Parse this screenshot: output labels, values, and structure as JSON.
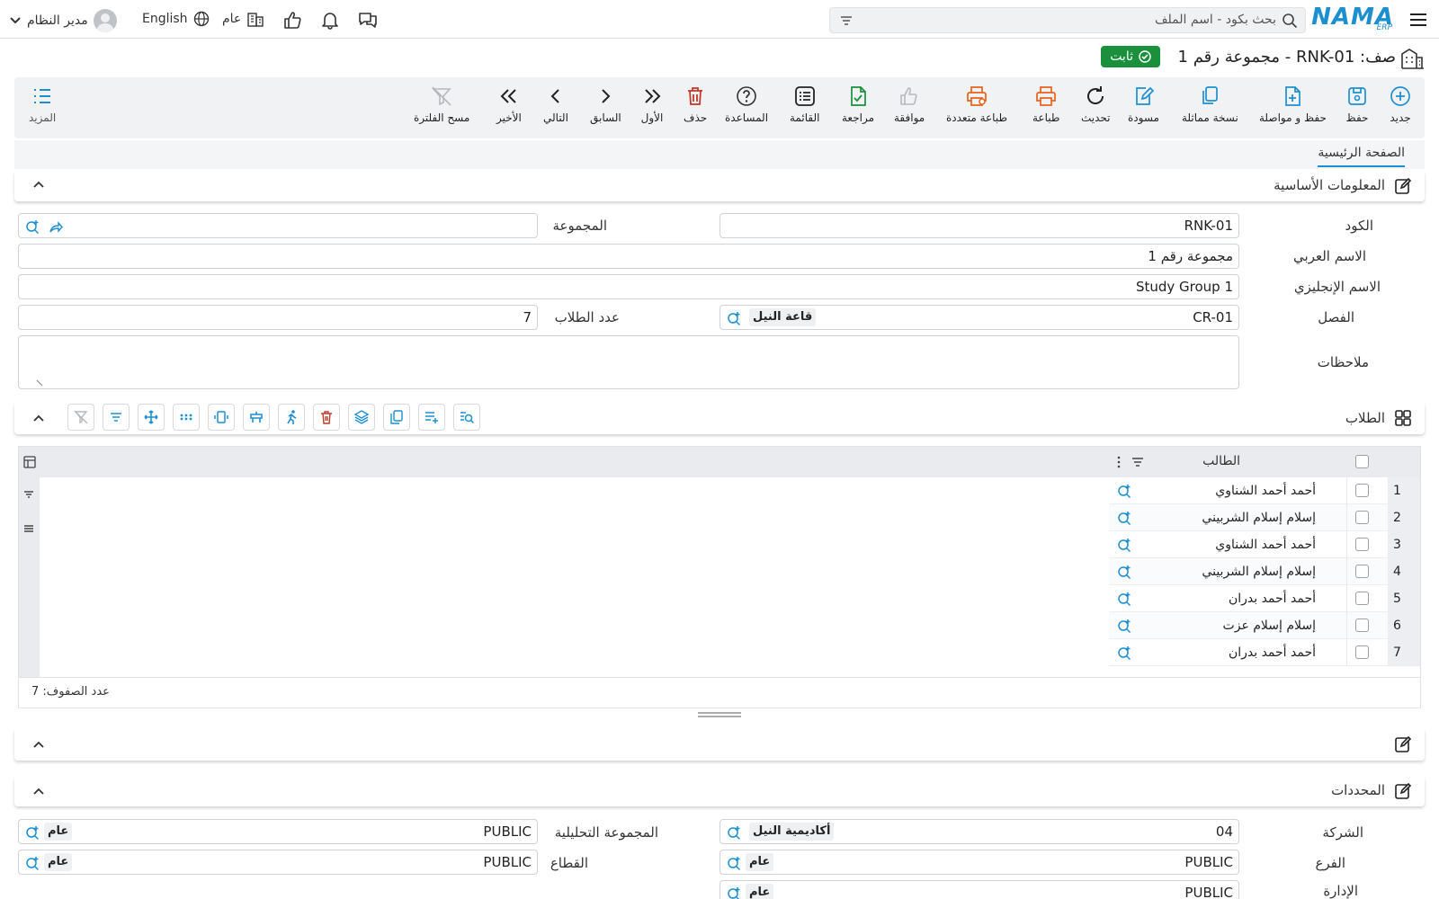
{
  "topbar": {
    "user_name": "مدير النظام",
    "language": "English",
    "branch": "عام",
    "search_placeholder": "بحث بكود - اسم الملف",
    "logo_main": "NAMA",
    "logo_sub": "ERP"
  },
  "page": {
    "title": "صف: RNK-01 - مجموعة رقم 1",
    "status": "ثابت"
  },
  "toolbar": {
    "more": "المزيد",
    "clear_filter": "مسح الفلترة",
    "last": "الأخير",
    "next": "التالي",
    "previous": "السابق",
    "first": "الأول",
    "delete": "حذف",
    "help": "المساعدة",
    "list": "القائمة",
    "review": "مراجعة",
    "approve": "موافقة",
    "multi_print": "طباعة متعددة",
    "print": "طباعة",
    "refresh": "تحديث",
    "draft": "مسودة",
    "duplicate": "نسخة مماثلة",
    "save_continue": "حفظ و مواصلة",
    "save": "حفظ",
    "new": "جديد"
  },
  "tabs": [
    "الصفحة الرئيسية"
  ],
  "basic_info": {
    "title": "المعلومات الأساسية",
    "code_label": "الكود",
    "code_value": "RNK-01",
    "group_label": "المجموعة",
    "group_value": "",
    "arabic_name_label": "الاسم العربي",
    "arabic_name_value": "مجموعة رقم 1",
    "english_name_label": "الاسم الإنجليزي",
    "english_name_value": "Study Group 1",
    "class_label": "الفصل",
    "class_code": "CR-01",
    "class_name": "قاعة النيل",
    "students_count_label": "عدد الطلاب",
    "students_count_value": "7",
    "notes_label": "ملاحظات",
    "notes_value": ""
  },
  "students": {
    "title": "الطلاب",
    "column_header": "الطالب",
    "rows": [
      {
        "num": "1",
        "name": "أحمد أحمد الشناوي"
      },
      {
        "num": "2",
        "name": "إسلام إسلام الشربيني"
      },
      {
        "num": "3",
        "name": "أحمد أحمد الشناوي"
      },
      {
        "num": "4",
        "name": "إسلام إسلام الشربيني"
      },
      {
        "num": "5",
        "name": "أحمد أحمد بدران"
      },
      {
        "num": "6",
        "name": "إسلام إسلام عزت"
      },
      {
        "num": "7",
        "name": "أحمد أحمد بدران"
      }
    ],
    "row_count": "عدد الصفوف: 7"
  },
  "determinants": {
    "title": "المحددات",
    "company_label": "الشركة",
    "company_code": "04",
    "company_name": "أكاديمية النيل",
    "analytic_group_label": "المجموعة التحليلية",
    "analytic_group_code": "PUBLIC",
    "analytic_group_name": "عام",
    "branch_label": "الفرع",
    "branch_code": "PUBLIC",
    "branch_name": "عام",
    "sector_label": "القطاع",
    "sector_code": "PUBLIC",
    "sector_name": "عام",
    "dept_label": "الإدارة",
    "dept_code": "PUBLIC",
    "dept_name": "عام"
  },
  "colors": {
    "accent": "#1d8fd0",
    "status_green": "#1a8f3c",
    "delete_red": "#c0392b",
    "print_orange": "#e8621a"
  }
}
